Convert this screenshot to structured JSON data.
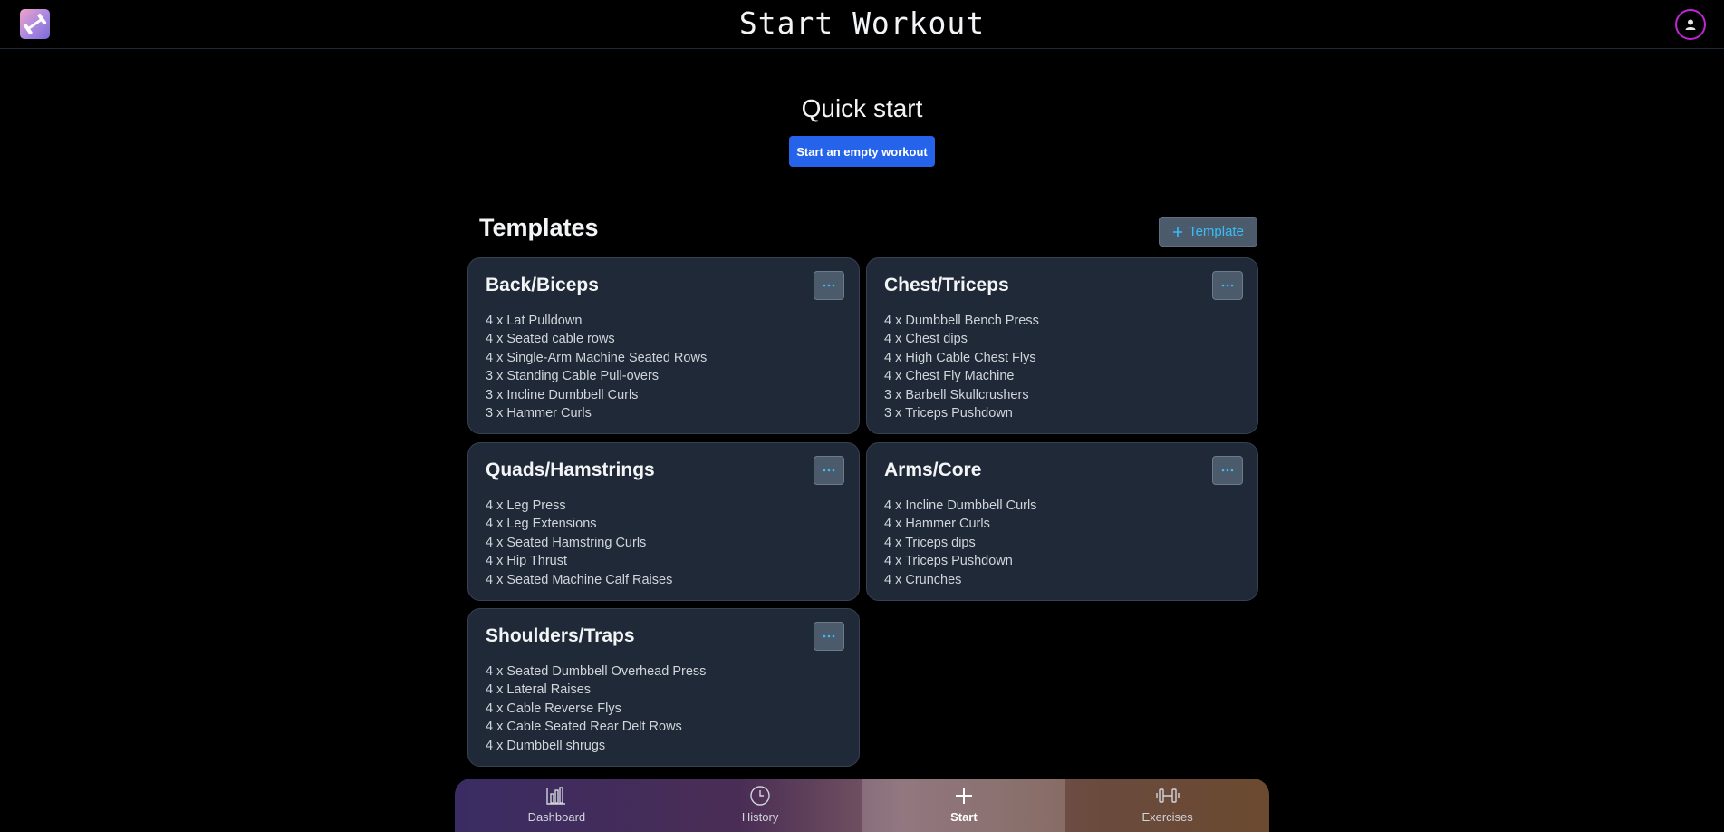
{
  "header": {
    "title": "Start Workout",
    "logo_icon": "dumbbell-logo-icon",
    "profile_icon": "user-icon"
  },
  "quick_start": {
    "title": "Quick start",
    "button_label": "Start an empty workout"
  },
  "templates": {
    "title": "Templates",
    "add_button_label": "Template",
    "cards": [
      {
        "name": "Back/Biceps",
        "exercises": [
          "4 x Lat Pulldown",
          "4 x Seated cable rows",
          "4 x Single-Arm Machine Seated Rows",
          "3 x Standing Cable Pull-overs",
          "3 x Incline Dumbbell Curls",
          "3 x Hammer Curls"
        ]
      },
      {
        "name": "Chest/Triceps",
        "exercises": [
          "4 x Dumbbell Bench Press",
          "4 x Chest dips",
          "4 x High Cable Chest Flys",
          "4 x Chest Fly Machine",
          "3 x Barbell Skullcrushers",
          "3 x Triceps Pushdown"
        ]
      },
      {
        "name": "Quads/Hamstrings",
        "exercises": [
          "4 x Leg Press",
          "4 x Leg Extensions",
          "4 x Seated Hamstring Curls",
          "4 x Hip Thrust",
          "4 x Seated Machine Calf Raises"
        ]
      },
      {
        "name": "Arms/Core",
        "exercises": [
          "4 x Incline Dumbbell Curls",
          "4 x Hammer Curls",
          "4 x Triceps dips",
          "4 x Triceps Pushdown",
          "4 x Crunches"
        ]
      },
      {
        "name": "Shoulders/Traps",
        "exercises": [
          "4 x Seated Dumbbell Overhead Press",
          "4 x Lateral Raises",
          "4 x Cable Reverse Flys",
          "4 x Cable Seated Rear Delt Rows",
          "4 x Dumbbell shrugs"
        ]
      }
    ]
  },
  "nav": {
    "items": [
      {
        "label": "Dashboard",
        "icon": "bar-chart-icon",
        "active": false
      },
      {
        "label": "History",
        "icon": "clock-icon",
        "active": false
      },
      {
        "label": "Start",
        "icon": "plus-icon",
        "active": true
      },
      {
        "label": "Exercises",
        "icon": "dumbbell-icon",
        "active": false
      }
    ]
  },
  "colors": {
    "accent_blue": "#2563eb",
    "card_bg": "#1f2937",
    "profile_ring": "#c026d3",
    "link_blue": "#38bdf8"
  }
}
